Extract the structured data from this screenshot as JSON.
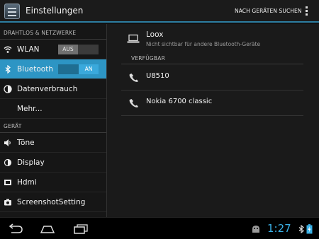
{
  "action_bar": {
    "title": "Einstellungen",
    "search_action": "NACH GERÄTEN SUCHEN"
  },
  "sidebar": {
    "sections": [
      {
        "header": "DRAHTLOS & NETZWERKE"
      },
      {
        "header": "GERÄT"
      }
    ],
    "items": [
      {
        "label": "WLAN",
        "icon": "wifi-icon",
        "toggle": "AUS"
      },
      {
        "label": "Bluetooth",
        "icon": "bluetooth-icon",
        "toggle": "AN",
        "selected": true
      },
      {
        "label": "Datenverbrauch",
        "icon": "data-usage-icon"
      },
      {
        "label": "Mehr..."
      },
      {
        "label": "Töne",
        "icon": "speaker-icon"
      },
      {
        "label": "Display",
        "icon": "brightness-icon"
      },
      {
        "label": "Hdmi",
        "icon": "hdmi-icon"
      },
      {
        "label": "ScreenshotSetting",
        "icon": "camera-icon"
      }
    ]
  },
  "bluetooth": {
    "local_device": {
      "name": "Loox",
      "visibility": "Nicht sichtbar für andere Bluetooth-Geräte",
      "icon": "laptop-icon"
    },
    "available_header": "VERFÜGBAR",
    "devices": [
      {
        "name": "U8510",
        "icon": "phone-icon"
      },
      {
        "name": "Nokia 6700 classic",
        "icon": "phone-icon"
      }
    ]
  },
  "system_bar": {
    "time": "1:27",
    "colors": {
      "accent": "#33b5e5",
      "selected": "#2d95c4"
    }
  }
}
